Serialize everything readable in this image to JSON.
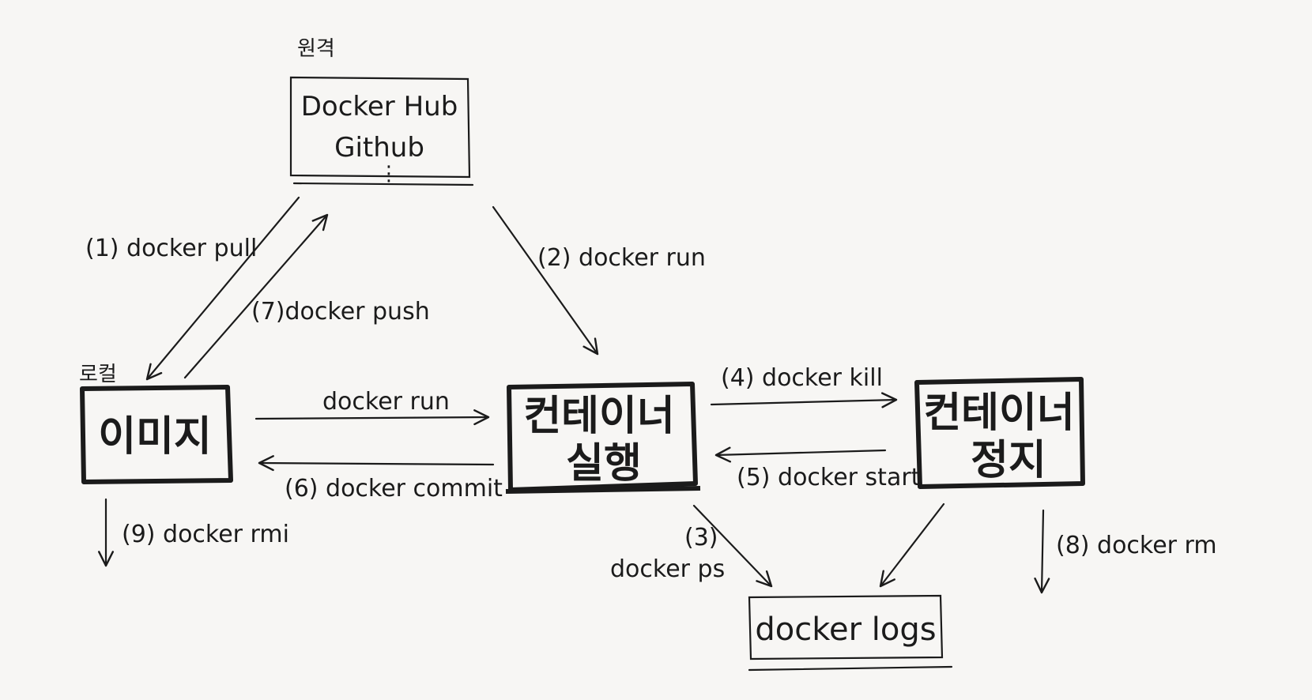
{
  "nodes": {
    "remote": {
      "caption": "원격",
      "line1": "Docker Hub",
      "line2": "Github",
      "line3": "⋮"
    },
    "local_image": {
      "caption": "로컬",
      "text": "이미지"
    },
    "container_running": {
      "line1": "컨테이너",
      "line2": "실행"
    },
    "container_stopped": {
      "line1": "컨테이너",
      "line2": "정지"
    },
    "logs": {
      "text": "docker logs"
    }
  },
  "edges": {
    "pull": "(1) docker pull",
    "remote_run": "(2) docker run",
    "ps_num": "(3)",
    "ps": "docker ps",
    "kill": "(4) docker kill",
    "start": "(5) docker start",
    "commit": "(6) docker commit",
    "push": "(7)docker push",
    "rm": "(8) docker rm",
    "rmi": "(9) docker rmi",
    "local_run": "docker run"
  }
}
